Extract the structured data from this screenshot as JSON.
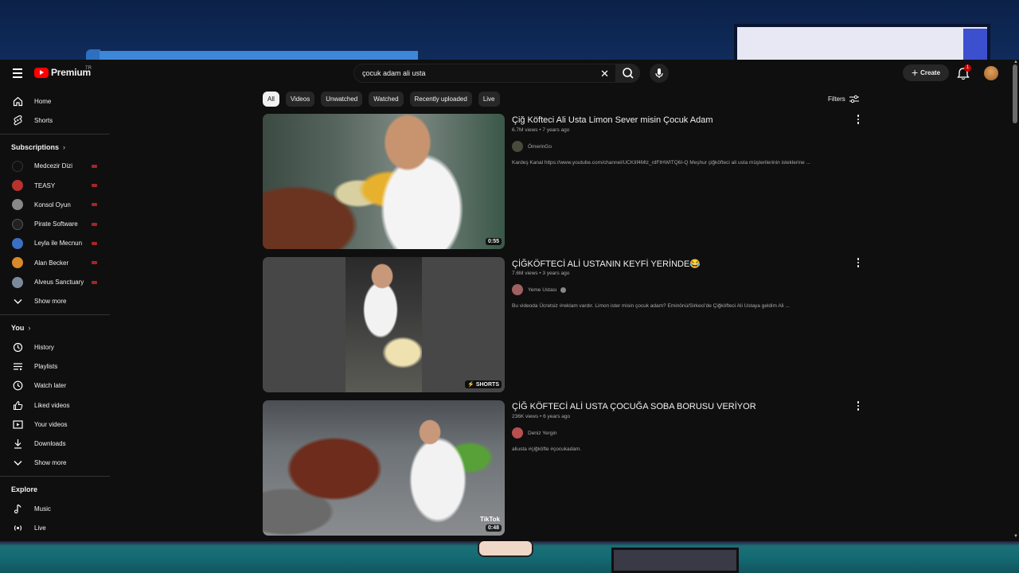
{
  "header": {
    "logo_text": "Premium",
    "logo_tr": "TR",
    "search_value": "çocuk adam ali usta",
    "create_label": "Create",
    "notification_count": "1"
  },
  "sidebar": {
    "main": [
      {
        "label": "Home",
        "icon": "home-icon"
      },
      {
        "label": "Shorts",
        "icon": "shorts-icon"
      }
    ],
    "subscriptions_title": "Subscriptions",
    "subscriptions": [
      {
        "label": "Medcezir Dizi",
        "color": "#111111"
      },
      {
        "label": "TEASY",
        "color": "#b8332f"
      },
      {
        "label": "Konsol Oyun",
        "color": "#888888"
      },
      {
        "label": "Pirate Software",
        "color": "#222222"
      },
      {
        "label": "Leyla ile Mecnun",
        "color": "#3a6fc4"
      },
      {
        "label": "Alan Becker",
        "color": "#d88a2a"
      },
      {
        "label": "Alveus Sanctuary",
        "color": "#7a8a9a"
      }
    ],
    "subs_show_more": "Show more",
    "you_title": "You",
    "you_items": [
      {
        "label": "History",
        "icon": "history-icon"
      },
      {
        "label": "Playlists",
        "icon": "playlists-icon"
      },
      {
        "label": "Watch later",
        "icon": "watch-later-icon"
      },
      {
        "label": "Liked videos",
        "icon": "thumbs-up-icon"
      },
      {
        "label": "Your videos",
        "icon": "your-videos-icon"
      },
      {
        "label": "Downloads",
        "icon": "download-icon"
      }
    ],
    "you_show_more": "Show more",
    "explore_title": "Explore",
    "explore_items": [
      {
        "label": "Music",
        "icon": "music-icon"
      },
      {
        "label": "Live",
        "icon": "live-icon"
      }
    ]
  },
  "chips": [
    "All",
    "Videos",
    "Unwatched",
    "Watched",
    "Recently uploaded",
    "Live"
  ],
  "filters_label": "Filters",
  "results": [
    {
      "title": "Çiğ Köfteci Ali Usta Limon Sever misin Çocuk Adam",
      "meta": "6.7M views • 7 years ago",
      "channel": "ÖmerinGo",
      "description": "Kardeş Kanal https://www.youtube.com/channel/UCKIif4Mlz_rdFtHWITQ6I-Q Meşhur çiğköfteci ali usta müşterilerinin isteklerine ...",
      "duration": "0:55"
    },
    {
      "title": "ÇİĞKÖFTECİ ALİ USTANIN KEYFİ YERİNDE😂",
      "meta": "7.6M views • 3 years ago",
      "channel": "Yeme Ustası",
      "description": "Bu videoda Ücretsiz #reklam vardır. Limon ister misin çocuk adam? Eminönü/Sirkeci'de Çiğköfteci Ali Ustaya geldim Ali ...",
      "badge": "SHORTS"
    },
    {
      "title": "ÇİĞ KÖFTECİ ALİ USTA ÇOCUĞA SOBA BORUSU VERİYOR",
      "meta": "236K views • 6 years ago",
      "channel": "Deniz Yergin",
      "description": "aliusta #çiğköfte #çocukadam.",
      "duration": "0:48",
      "watermark": "TikTok"
    }
  ]
}
